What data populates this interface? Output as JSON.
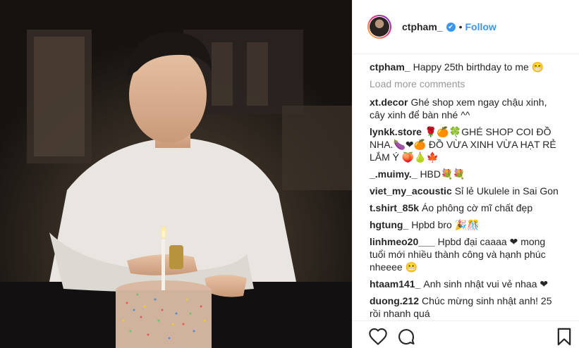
{
  "post": {
    "username": "ctpham_",
    "follow_label": "Follow",
    "separator": "•",
    "verified_glyph": "✔"
  },
  "load_more_label": "Load more comments",
  "comments": [
    {
      "user": "ctpham_",
      "text": "Happy 25th birthday to me 😁"
    },
    {
      "user": "xt.decor",
      "text": "Ghé shop xem ngay chậu xinh, cây xinh để bàn nhé ^^"
    },
    {
      "user": "lynkk.store",
      "text": "🌹🍊🍀GHÉ SHOP COI ĐỒ NHA.🍆❤🍊 ĐỒ VỪA XINH VỪA HẠT RẺ LẮM Ý 🍑🍐🍁"
    },
    {
      "user": "_.muimy._",
      "text": "HBD💐💐"
    },
    {
      "user": "viet_my_acoustic",
      "text": "Sỉ lẻ Ukulele in Sai Gon"
    },
    {
      "user": "t.shirt_85k",
      "text": "Áo phông cờ mĩ chất đẹp"
    },
    {
      "user": "hgtung_",
      "text": "Hpbd bro 🎉🎊"
    },
    {
      "user": "linhmeo20___",
      "text": "Hpbd đại caaaa ❤ mong tuổi mới nhiều thành công và hạnh phúc nheeee 😬"
    },
    {
      "user": "htaam141_",
      "text": "Anh sinh nhật vui vẻ nhaa ❤"
    },
    {
      "user": "duong.212",
      "text": "Chúc mừng sinh nhật anh! 25 rồi nhanh quá"
    }
  ],
  "icons": {
    "like": "heart-icon",
    "comment": "comment-bubble-icon",
    "bookmark": "bookmark-icon",
    "verified": "verified-badge-icon"
  },
  "colors": {
    "link_blue": "#3897f0",
    "muted": "#999999",
    "text": "#262626",
    "heart": "#ed4956"
  }
}
